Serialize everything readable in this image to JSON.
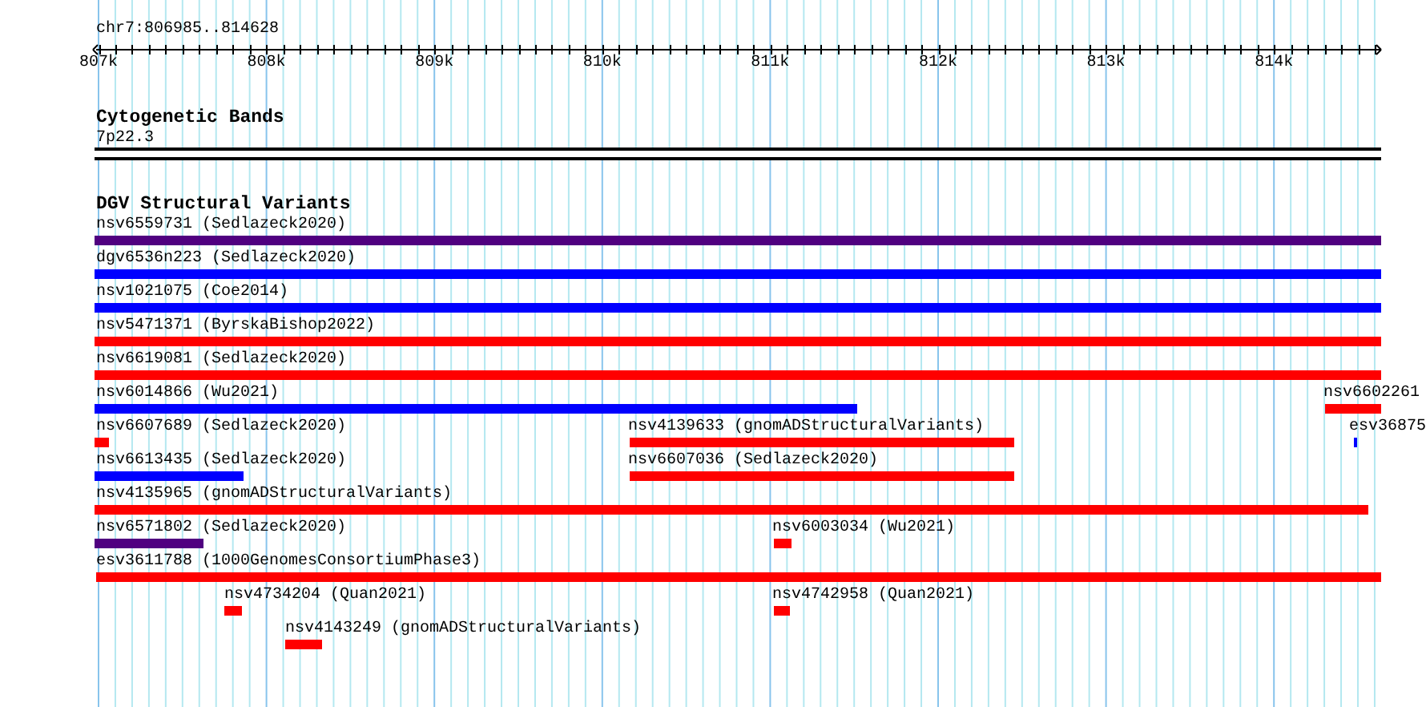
{
  "ruler": {
    "location": "chr7:806985..814628",
    "ticks": [
      "807k",
      "808k",
      "809k",
      "810k",
      "811k",
      "812k",
      "813k",
      "814k"
    ]
  },
  "tracks": [
    {
      "title": "Cytogenetic Bands",
      "features": [
        {
          "label": "7p22.3",
          "kind": "band"
        }
      ]
    },
    {
      "title": "DGV Structural Variants",
      "features": [
        {
          "label": "nsv6559731 (Sedlazeck2020)",
          "color": "#500080",
          "kind": "variant"
        },
        {
          "label": "dgv6536n223 (Sedlazeck2020)",
          "color": "#0000ff",
          "kind": "variant"
        },
        {
          "label": "nsv1021075 (Coe2014)",
          "color": "#0000ff",
          "kind": "variant"
        },
        {
          "label": "nsv5471371 (ByrskaBishop2022)",
          "color": "#ff0000",
          "kind": "variant"
        },
        {
          "label": "nsv6619081 (Sedlazeck2020)",
          "color": "#ff0000",
          "kind": "variant"
        },
        {
          "label": "nsv6014866 (Wu2021)",
          "color": "#0000ff",
          "kind": "variant"
        },
        {
          "label": "nsv6602261",
          "color": "#ff0000",
          "kind": "variant"
        },
        {
          "label": "nsv6607689 (Sedlazeck2020)",
          "color": "#ff0000",
          "kind": "variant"
        },
        {
          "label": "nsv4139633 (gnomADStructuralVariants)",
          "color": "#ff0000",
          "kind": "variant"
        },
        {
          "label": "esv36875",
          "color": "#0000ff",
          "kind": "variant"
        },
        {
          "label": "nsv6613435 (Sedlazeck2020)",
          "color": "#0000ff",
          "kind": "variant"
        },
        {
          "label": "nsv6607036 (Sedlazeck2020)",
          "color": "#ff0000",
          "kind": "variant"
        },
        {
          "label": "nsv4135965 (gnomADStructuralVariants)",
          "color": "#ff0000",
          "kind": "variant"
        },
        {
          "label": "nsv6571802 (Sedlazeck2020)",
          "color": "#500080",
          "kind": "variant"
        },
        {
          "label": "nsv6003034 (Wu2021)",
          "color": "#ff0000",
          "kind": "variant"
        },
        {
          "label": "esv3611788 (1000GenomesConsortiumPhase3)",
          "color": "#ff0000",
          "kind": "variant"
        },
        {
          "label": "nsv4734204 (Quan2021)",
          "color": "#ff0000",
          "kind": "variant"
        },
        {
          "label": "nsv4742958 (Quan2021)",
          "color": "#ff0000",
          "kind": "variant"
        },
        {
          "label": "nsv4143249 (gnomADStructuralVariants)",
          "color": "#ff0000",
          "kind": "variant"
        }
      ]
    }
  ]
}
